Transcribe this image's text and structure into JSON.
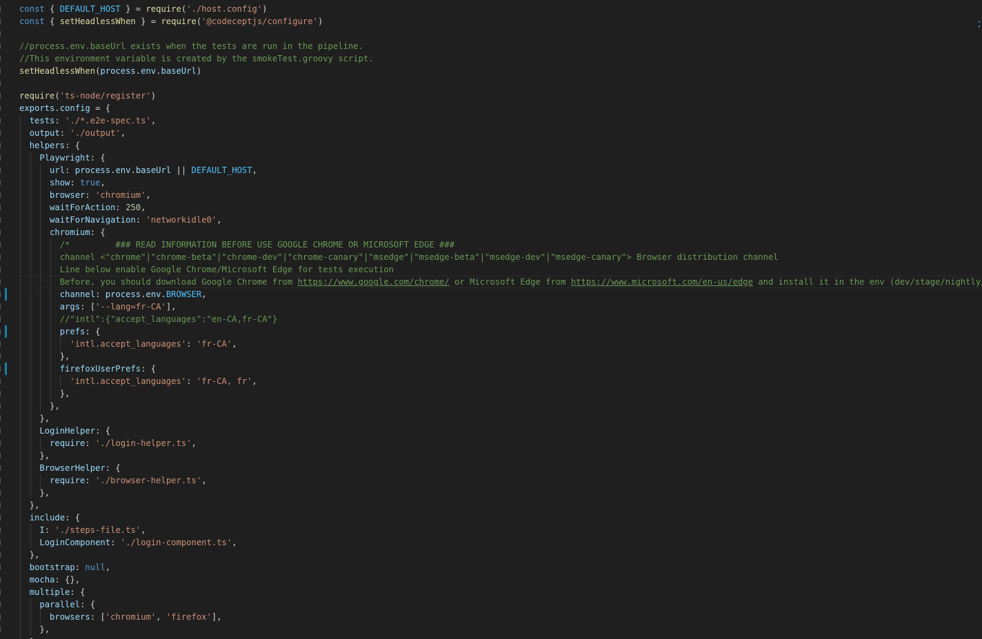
{
  "editor": {
    "language": "javascript",
    "lines": [
      {
        "indent": 0,
        "tokens": [
          [
            "kw",
            "const"
          ],
          [
            "pun",
            " { "
          ],
          [
            "const",
            "DEFAULT_HOST"
          ],
          [
            "pun",
            " } = "
          ],
          [
            "fn",
            "require"
          ],
          [
            "pun",
            "("
          ],
          [
            "str",
            "'./host.config'"
          ],
          [
            "pun",
            ")"
          ]
        ]
      },
      {
        "indent": 0,
        "tokens": [
          [
            "kw",
            "const"
          ],
          [
            "pun",
            " { "
          ],
          [
            "fn",
            "setHeadlessWhen"
          ],
          [
            "pun",
            " } = "
          ],
          [
            "fn",
            "require"
          ],
          [
            "pun",
            "("
          ],
          [
            "str",
            "'@codeceptjs/configure'"
          ],
          [
            "pun",
            ")"
          ]
        ]
      },
      {
        "indent": 0,
        "tokens": []
      },
      {
        "indent": 0,
        "tokens": [
          [
            "com",
            "//process.env.baseUrl exists when the tests are run in the pipeline."
          ]
        ]
      },
      {
        "indent": 0,
        "tokens": [
          [
            "com",
            "//This environment variable is created by the smokeTest.groovy script."
          ]
        ]
      },
      {
        "indent": 0,
        "tokens": [
          [
            "fn",
            "setHeadlessWhen"
          ],
          [
            "pun",
            "("
          ],
          [
            "var",
            "process"
          ],
          [
            "pun",
            "."
          ],
          [
            "var",
            "env"
          ],
          [
            "pun",
            "."
          ],
          [
            "var",
            "baseUrl"
          ],
          [
            "pun",
            ")"
          ]
        ]
      },
      {
        "indent": 0,
        "tokens": []
      },
      {
        "indent": 0,
        "tokens": [
          [
            "fn",
            "require"
          ],
          [
            "pun",
            "("
          ],
          [
            "str",
            "'ts-node/register'"
          ],
          [
            "pun",
            ")"
          ]
        ]
      },
      {
        "indent": 0,
        "tokens": [
          [
            "var",
            "exports"
          ],
          [
            "pun",
            "."
          ],
          [
            "var",
            "config"
          ],
          [
            "pun",
            " = {"
          ]
        ]
      },
      {
        "indent": 1,
        "tokens": [
          [
            "var",
            "tests"
          ],
          [
            "pun",
            ": "
          ],
          [
            "str",
            "'./*.e2e-spec.ts'"
          ],
          [
            "pun",
            ","
          ]
        ]
      },
      {
        "indent": 1,
        "tokens": [
          [
            "var",
            "output"
          ],
          [
            "pun",
            ": "
          ],
          [
            "str",
            "'./output'"
          ],
          [
            "pun",
            ","
          ]
        ]
      },
      {
        "indent": 1,
        "tokens": [
          [
            "var",
            "helpers"
          ],
          [
            "pun",
            ": {"
          ]
        ]
      },
      {
        "indent": 2,
        "tokens": [
          [
            "var",
            "Playwright"
          ],
          [
            "pun",
            ": {"
          ]
        ]
      },
      {
        "indent": 3,
        "tokens": [
          [
            "var",
            "url"
          ],
          [
            "pun",
            ": "
          ],
          [
            "var",
            "process"
          ],
          [
            "pun",
            "."
          ],
          [
            "var",
            "env"
          ],
          [
            "pun",
            "."
          ],
          [
            "var",
            "baseUrl"
          ],
          [
            "pun",
            " || "
          ],
          [
            "const",
            "DEFAULT_HOST"
          ],
          [
            "pun",
            ","
          ]
        ]
      },
      {
        "indent": 3,
        "tokens": [
          [
            "var",
            "show"
          ],
          [
            "pun",
            ": "
          ],
          [
            "lit",
            "true"
          ],
          [
            "pun",
            ","
          ]
        ]
      },
      {
        "indent": 3,
        "tokens": [
          [
            "var",
            "browser"
          ],
          [
            "pun",
            ": "
          ],
          [
            "str",
            "'chromium'"
          ],
          [
            "pun",
            ","
          ]
        ]
      },
      {
        "indent": 3,
        "tokens": [
          [
            "var",
            "waitForAction"
          ],
          [
            "pun",
            ": "
          ],
          [
            "num",
            "250"
          ],
          [
            "pun",
            ","
          ]
        ]
      },
      {
        "indent": 3,
        "tokens": [
          [
            "var",
            "waitForNavigation"
          ],
          [
            "pun",
            ": "
          ],
          [
            "str",
            "'networkidle0'"
          ],
          [
            "pun",
            ","
          ]
        ]
      },
      {
        "indent": 3,
        "tokens": [
          [
            "var",
            "chromium"
          ],
          [
            "pun",
            ": "
          ],
          [
            "pun",
            "{"
          ]
        ]
      },
      {
        "indent": 4,
        "tokens": [
          [
            "com",
            "/*         ### READ INFORMATION BEFORE USE GOOGLE CHROME OR MICROSOFT EDGE ###"
          ]
        ]
      },
      {
        "indent": 4,
        "tokens": [
          [
            "com",
            "channel <\"chrome\"|\"chrome-beta\"|\"chrome-dev\"|\"chrome-canary\"|\"msedge\"|\"msedge-beta\"|\"msedge-dev\"|\"msedge-canary\"> Browser distribution channel"
          ]
        ]
      },
      {
        "indent": 4,
        "tokens": [
          [
            "com",
            "Line below enable Google Chrome/Microsoft Edge for tests execution"
          ]
        ]
      },
      {
        "indent": 4,
        "hl": true,
        "tokens": [
          [
            "com",
            "Before, you should download Google Chrome from "
          ],
          [
            "link",
            "https://www.google.com/chrome/"
          ],
          [
            "com",
            " or Microsoft Edge from "
          ],
          [
            "link",
            "https://www.microsoft.com/en-us/edge"
          ],
          [
            "com",
            " and install it in the env (dev/stage/nightly/p"
          ]
        ]
      },
      {
        "indent": 4,
        "tokens": [
          [
            "var",
            "channel"
          ],
          [
            "pun",
            ": "
          ],
          [
            "var",
            "process"
          ],
          [
            "pun",
            "."
          ],
          [
            "var",
            "env"
          ],
          [
            "pun",
            "."
          ],
          [
            "const",
            "BROWSER"
          ],
          [
            "pun",
            ","
          ]
        ]
      },
      {
        "indent": 4,
        "tokens": [
          [
            "var",
            "args"
          ],
          [
            "pun",
            ": ["
          ],
          [
            "str",
            "'--lang=fr-CA'"
          ],
          [
            "pun",
            "],"
          ]
        ]
      },
      {
        "indent": 4,
        "tokens": [
          [
            "com",
            "//\"intl\":{\"accept_languages\":\"en-CA,fr-CA\"}"
          ]
        ]
      },
      {
        "indent": 4,
        "tokens": [
          [
            "var",
            "prefs"
          ],
          [
            "pun",
            ": {"
          ]
        ]
      },
      {
        "indent": 5,
        "tokens": [
          [
            "str",
            "'intl.accept_languages'"
          ],
          [
            "pun",
            ": "
          ],
          [
            "str",
            "'fr-CA'"
          ],
          [
            "pun",
            ","
          ]
        ]
      },
      {
        "indent": 4,
        "tokens": [
          [
            "pun",
            "},"
          ]
        ]
      },
      {
        "indent": 4,
        "tokens": [
          [
            "var",
            "firefoxUserPrefs"
          ],
          [
            "pun",
            ": {"
          ]
        ]
      },
      {
        "indent": 5,
        "tokens": [
          [
            "str",
            "'intl.accept_languages'"
          ],
          [
            "pun",
            ": "
          ],
          [
            "str",
            "'fr-CA, fr'"
          ],
          [
            "pun",
            ","
          ]
        ]
      },
      {
        "indent": 4,
        "tokens": [
          [
            "pun",
            "},"
          ]
        ]
      },
      {
        "indent": 3,
        "tokens": [
          [
            "pun",
            "},"
          ]
        ]
      },
      {
        "indent": 2,
        "tokens": [
          [
            "pun",
            "},"
          ]
        ]
      },
      {
        "indent": 2,
        "tokens": [
          [
            "var",
            "LoginHelper"
          ],
          [
            "pun",
            ": {"
          ]
        ]
      },
      {
        "indent": 3,
        "tokens": [
          [
            "var",
            "require"
          ],
          [
            "pun",
            ": "
          ],
          [
            "str",
            "'./login-helper.ts'"
          ],
          [
            "pun",
            ","
          ]
        ]
      },
      {
        "indent": 2,
        "tokens": [
          [
            "pun",
            "},"
          ]
        ]
      },
      {
        "indent": 2,
        "tokens": [
          [
            "var",
            "BrowserHelper"
          ],
          [
            "pun",
            ": {"
          ]
        ]
      },
      {
        "indent": 3,
        "tokens": [
          [
            "var",
            "require"
          ],
          [
            "pun",
            ": "
          ],
          [
            "str",
            "'./browser-helper.ts'"
          ],
          [
            "pun",
            ","
          ]
        ]
      },
      {
        "indent": 2,
        "tokens": [
          [
            "pun",
            "},"
          ]
        ]
      },
      {
        "indent": 1,
        "tokens": [
          [
            "pun",
            "},"
          ]
        ]
      },
      {
        "indent": 1,
        "tokens": [
          [
            "var",
            "include"
          ],
          [
            "pun",
            ": {"
          ]
        ]
      },
      {
        "indent": 2,
        "tokens": [
          [
            "var",
            "I"
          ],
          [
            "pun",
            ": "
          ],
          [
            "str",
            "'./steps-file.ts'"
          ],
          [
            "pun",
            ","
          ]
        ]
      },
      {
        "indent": 2,
        "tokens": [
          [
            "var",
            "LoginComponent"
          ],
          [
            "pun",
            ": "
          ],
          [
            "str",
            "'./login-component.ts'"
          ],
          [
            "pun",
            ","
          ]
        ]
      },
      {
        "indent": 1,
        "tokens": [
          [
            "pun",
            "},"
          ]
        ]
      },
      {
        "indent": 1,
        "tokens": [
          [
            "var",
            "bootstrap"
          ],
          [
            "pun",
            ": "
          ],
          [
            "lit",
            "null"
          ],
          [
            "pun",
            ","
          ]
        ]
      },
      {
        "indent": 1,
        "tokens": [
          [
            "var",
            "mocha"
          ],
          [
            "pun",
            ": {},"
          ]
        ]
      },
      {
        "indent": 1,
        "tokens": [
          [
            "var",
            "multiple"
          ],
          [
            "pun",
            ": {"
          ]
        ]
      },
      {
        "indent": 2,
        "tokens": [
          [
            "var",
            "parallel"
          ],
          [
            "pun",
            ": {"
          ]
        ]
      },
      {
        "indent": 3,
        "tokens": [
          [
            "var",
            "browsers"
          ],
          [
            "pun",
            ": ["
          ],
          [
            "str",
            "'chromium'"
          ],
          [
            "pun",
            ", "
          ],
          [
            "str",
            "'firefox'"
          ],
          [
            "pun",
            "],"
          ]
        ]
      },
      {
        "indent": 2,
        "tokens": [
          [
            "pun",
            "},"
          ]
        ]
      },
      {
        "indent": 1,
        "tokens": [
          [
            "pun",
            "},"
          ]
        ]
      }
    ],
    "modified_lines": [
      24,
      27,
      30
    ],
    "colors": {
      "background": "#1f1f1f",
      "keyword": "#569cd6",
      "variable": "#9cdcfe",
      "constant": "#4fc1ff",
      "function": "#dcdcaa",
      "string": "#ce9178",
      "number": "#b5cea8",
      "comment": "#6a9955",
      "modified_marker": "#1b81a8"
    }
  }
}
